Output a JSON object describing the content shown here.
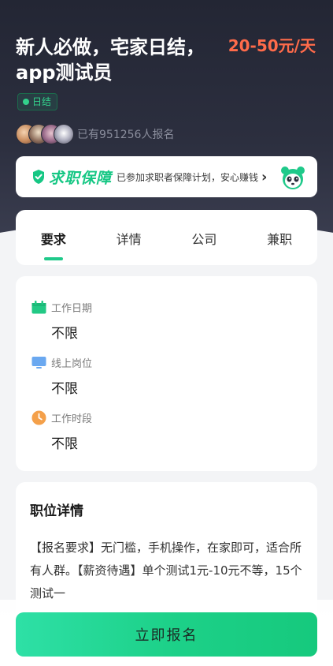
{
  "job": {
    "title": "新人必做，宅家日结，app测试员",
    "salary": "20-50元/天",
    "tag": "日结",
    "signups": "已有951256人报名"
  },
  "guarantee": {
    "title": "求职保障",
    "desc": "已参加求职者保障计划，安心赚钱",
    "arrow": "›",
    "icons": [
      "shield-icon",
      "panda-mascot-icon"
    ]
  },
  "tabs": [
    {
      "label": "要求",
      "active": true
    },
    {
      "label": "详情",
      "active": false
    },
    {
      "label": "公司",
      "active": false
    },
    {
      "label": "兼职",
      "active": false
    }
  ],
  "requirements": [
    {
      "icon": "calendar-icon",
      "label": "工作日期",
      "value": "不限"
    },
    {
      "icon": "monitor-icon",
      "label": "线上岗位",
      "value": "不限"
    },
    {
      "icon": "clock-icon",
      "label": "工作时段",
      "value": "不限"
    }
  ],
  "details": {
    "title": "职位详情",
    "text": "【报名要求】无门槛，手机操作，在家即可，适合所有人群。【薪资待遇】单个测试1元-10元不等，15个测试一"
  },
  "footer": {
    "apply_label": "立即报名"
  },
  "colors": {
    "accent": "#1fc98a",
    "salary": "#ff6b4a",
    "hero_bg": "#232634"
  }
}
